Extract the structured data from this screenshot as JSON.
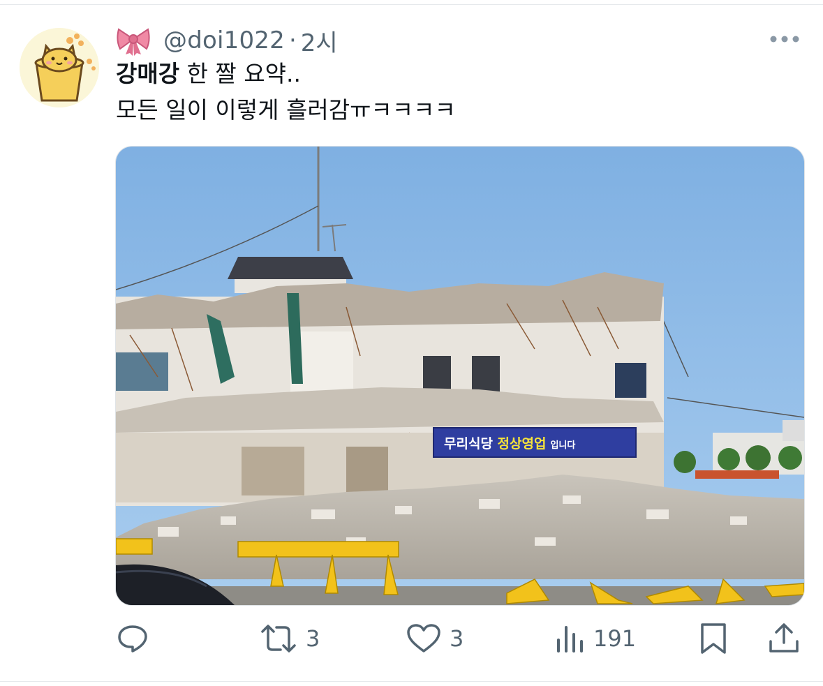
{
  "tweet": {
    "display_name_emoji": "🎀",
    "handle": "@doi1022",
    "separator": "·",
    "time": "2시",
    "text_bold": "강매강",
    "text_line1_rest": " 한 짤 요약..",
    "text_line2": "모든 일이 이렇게 흘러감ㅠㅋㅋㅋㅋ"
  },
  "media": {
    "banner_text_1": "무리식당 ",
    "banner_text_highlight": "정상영업",
    "banner_text_2": "입니다"
  },
  "actions": {
    "reply_count": "",
    "retweet_count": "3",
    "like_count": "3",
    "views_count": "191"
  },
  "colors": {
    "text": "#0f1419",
    "secondary": "#536471",
    "sky": "#8dbbe6",
    "banner": "#2f3ea0"
  }
}
